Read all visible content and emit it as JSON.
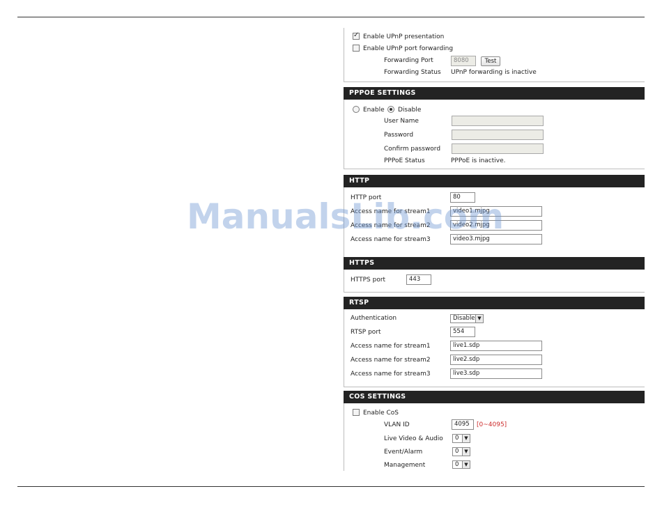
{
  "upnp": {
    "presentation_label": "Enable UPnP presentation",
    "presentation_checked": true,
    "forwarding_label": "Enable UPnP port forwarding",
    "forwarding_checked": false,
    "forwarding_port_label": "Forwarding Port",
    "forwarding_port_value": "8080",
    "test_button": "Test",
    "forwarding_status_label": "Forwarding Status",
    "forwarding_status_value": "UPnP forwarding is inactive"
  },
  "pppoe": {
    "title": "PPPOE SETTINGS",
    "enable_label": "Enable",
    "disable_label": "Disable",
    "selected": "Disable",
    "username_label": "User Name",
    "password_label": "Password",
    "confirm_label": "Confirm password",
    "status_label": "PPPoE Status",
    "status_value": "PPPoE is inactive."
  },
  "http": {
    "title": "HTTP",
    "port_label": "HTTP port",
    "port_value": "80",
    "stream1_label": "Access name for stream1",
    "stream1_value": "video1.mjpg",
    "stream2_label": "Access name for stream2",
    "stream2_value": "video2.mjpg",
    "stream3_label": "Access name for stream3",
    "stream3_value": "video3.mjpg"
  },
  "https": {
    "title": "HTTPS",
    "port_label": "HTTPS port",
    "port_value": "443"
  },
  "rtsp": {
    "title": "RTSP",
    "auth_label": "Authentication",
    "auth_value": "Disable",
    "port_label": "RTSP port",
    "port_value": "554",
    "stream1_label": "Access name for stream1",
    "stream1_value": "live1.sdp",
    "stream2_label": "Access name for stream2",
    "stream2_value": "live2.sdp",
    "stream3_label": "Access name for stream3",
    "stream3_value": "live3.sdp"
  },
  "cos": {
    "title": "COS SETTINGS",
    "enable_label": "Enable CoS",
    "enable_checked": false,
    "vlan_label": "VLAN ID",
    "vlan_value": "4095",
    "vlan_range": "[0~4095]",
    "live_label": "Live Video & Audio",
    "live_value": "0",
    "event_label": "Event/Alarm",
    "event_value": "0",
    "mgmt_label": "Management",
    "mgmt_value": "0"
  },
  "watermark": "ManualsLib.com",
  "colors": {
    "header_bg": "#232323",
    "header_text": "#ffffff",
    "range_text": "#cc2b2b",
    "watermark": "#6e96d2"
  },
  "icons": {
    "dropdown": "chevron-down-icon",
    "checkbox": "checkbox",
    "radio": "radio"
  }
}
